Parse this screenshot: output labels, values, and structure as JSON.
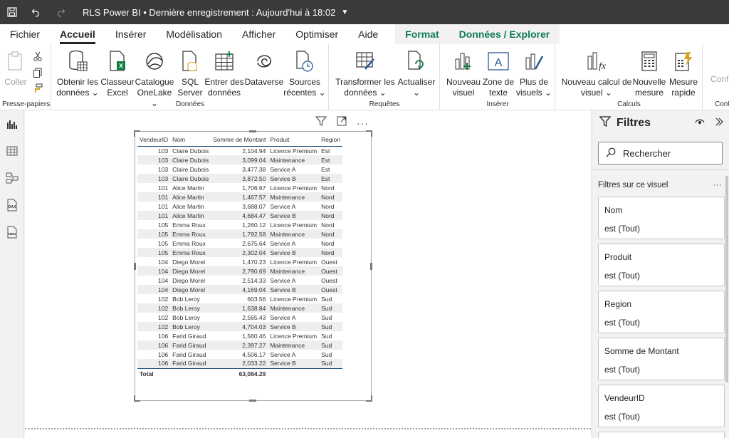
{
  "title": "RLS Power BI • Dernière enregistrement : Aujourd'hui à 18:02",
  "menu": [
    "Fichier",
    "Accueil",
    "Insérer",
    "Modélisation",
    "Afficher",
    "Optimiser",
    "Aide",
    "Format",
    "Données / Explorer"
  ],
  "ribbon": {
    "clipboard": {
      "paste": "Coller",
      "label": "Presse-papiers"
    },
    "donnees": {
      "label": "Données",
      "get_data_1": "Obtenir les",
      "get_data_2": "données",
      "excel_1": "Classeur",
      "excel_2": "Excel",
      "onelake_1": "Catalogue",
      "onelake_2": "OneLake",
      "sql_1": "SQL",
      "sql_2": "Server",
      "enter_1": "Entrer des",
      "enter_2": "données",
      "dataverse": "Dataverse",
      "recent_1": "Sources",
      "recent_2": "récentes"
    },
    "requetes": {
      "label": "Requêtes",
      "transform_1": "Transformer les",
      "transform_2": "données",
      "refresh": "Actualiser"
    },
    "inserer": {
      "label": "Insérer",
      "new_visual_1": "Nouveau",
      "new_visual_2": "visuel",
      "textbox_1": "Zone de",
      "textbox_2": "texte",
      "more_1": "Plus de",
      "more_2": "visuels"
    },
    "calculs": {
      "label": "Calculs",
      "newcalc_1": "Nouveau calcul de",
      "newcalc_2": "visuel",
      "newmeasure_1": "Nouvelle",
      "newmeasure_2": "mesure",
      "quick_1": "Mesure",
      "quick_2": "rapide"
    },
    "cut": {
      "label_1": "Confi",
      "label_2": "Conf"
    }
  },
  "table": {
    "headers": [
      "VendeurID",
      "Nom",
      "Somme de Montant",
      "Produit",
      "Region"
    ],
    "rows": [
      [
        "103",
        "Claire Dubois",
        "2,104.94",
        "Licence Premium",
        "Est"
      ],
      [
        "103",
        "Claire Dubois",
        "3,099.04",
        "Maintenance",
        "Est"
      ],
      [
        "103",
        "Claire Dubois",
        "3,477.38",
        "Service A",
        "Est"
      ],
      [
        "103",
        "Claire Dubois",
        "3,872.50",
        "Service B",
        "Est"
      ],
      [
        "101",
        "Alice Martin",
        "1,706.67",
        "Licence Premium",
        "Nord"
      ],
      [
        "101",
        "Alice Martin",
        "1,467.57",
        "Maintenance",
        "Nord"
      ],
      [
        "101",
        "Alice Martin",
        "3,688.07",
        "Service A",
        "Nord"
      ],
      [
        "101",
        "Alice Martin",
        "4,684.47",
        "Service B",
        "Nord"
      ],
      [
        "105",
        "Emma Roux",
        "1,260.12",
        "Licence Premium",
        "Nord"
      ],
      [
        "105",
        "Emma Roux",
        "1,792.58",
        "Maintenance",
        "Nord"
      ],
      [
        "105",
        "Emma Roux",
        "2,675.64",
        "Service A",
        "Nord"
      ],
      [
        "105",
        "Emma Roux",
        "2,302.04",
        "Service B",
        "Nord"
      ],
      [
        "104",
        "Diego Morel",
        "1,470.23",
        "Licence Premium",
        "Ouest"
      ],
      [
        "104",
        "Diego Morel",
        "2,790.69",
        "Maintenance",
        "Ouest"
      ],
      [
        "104",
        "Diego Morel",
        "2,514.33",
        "Service A",
        "Ouest"
      ],
      [
        "104",
        "Diego Morel",
        "4,169.04",
        "Service B",
        "Ouest"
      ],
      [
        "102",
        "Bob Leroy",
        "603.56",
        "Licence Premium",
        "Sud"
      ],
      [
        "102",
        "Bob Leroy",
        "1,638.84",
        "Maintenance",
        "Sud"
      ],
      [
        "102",
        "Bob Leroy",
        "2,565.43",
        "Service A",
        "Sud"
      ],
      [
        "102",
        "Bob Leroy",
        "4,704.03",
        "Service B",
        "Sud"
      ],
      [
        "106",
        "Farid Giraud",
        "1,560.46",
        "Licence Premium",
        "Sud"
      ],
      [
        "106",
        "Farid Giraud",
        "2,397.27",
        "Maintenance",
        "Sud"
      ],
      [
        "106",
        "Farid Giraud",
        "4,506.17",
        "Service A",
        "Sud"
      ],
      [
        "106",
        "Farid Giraud",
        "2,033.22",
        "Service B",
        "Sud"
      ]
    ],
    "total_label": "Total",
    "total_value": "63,084.29"
  },
  "filters": {
    "title": "Filtres",
    "search_placeholder": "Rechercher",
    "section": "Filtres sur ce visuel",
    "cards": [
      {
        "name": "Nom",
        "value": "est (Tout)"
      },
      {
        "name": "Produit",
        "value": "est (Tout)"
      },
      {
        "name": "Region",
        "value": "est (Tout)"
      },
      {
        "name": "Somme de Montant",
        "value": "est (Tout)"
      },
      {
        "name": "VendeurID",
        "value": "est (Tout)"
      }
    ]
  },
  "colors": {
    "titlebar": "#3b3a39",
    "context_tab": "#0e7a5e",
    "table_header_line": "#1f4e79"
  }
}
